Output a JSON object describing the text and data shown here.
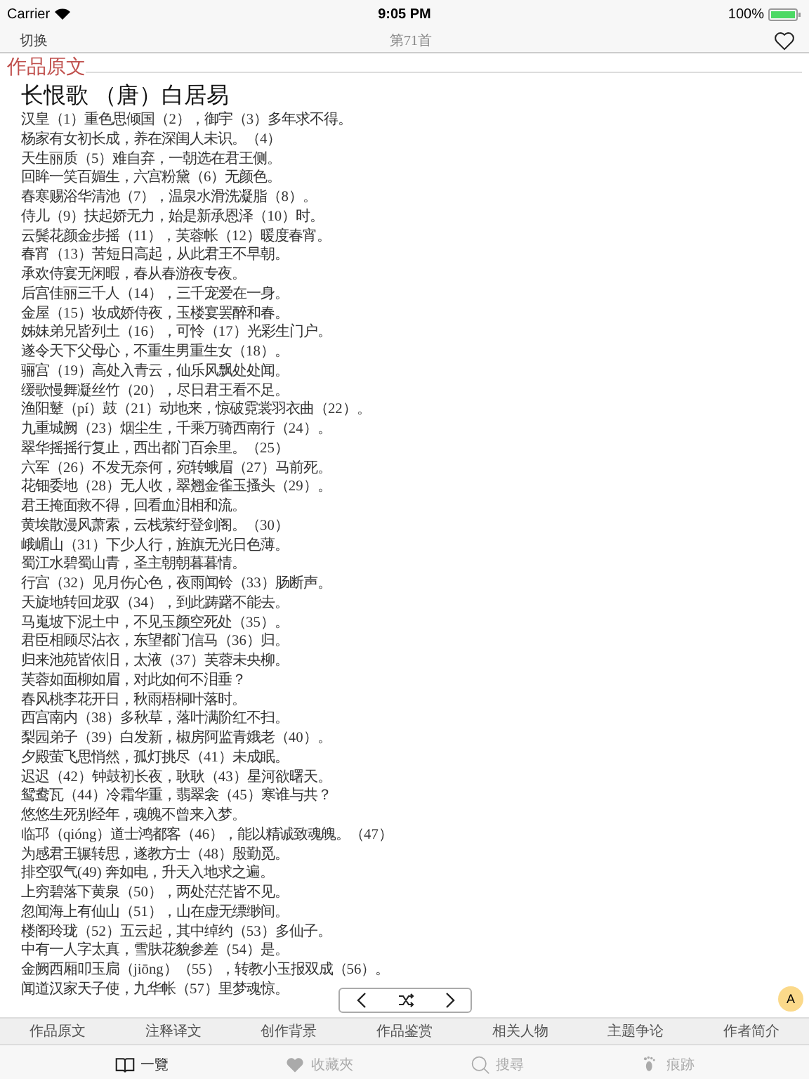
{
  "status_bar": {
    "carrier": "Carrier",
    "time": "9:05 PM",
    "battery": "100%"
  },
  "nav_bar": {
    "left_button": "切换",
    "title": "第71首",
    "favorited": false
  },
  "section_heading": "作品原文",
  "poem_title": "长恨歌 （唐）白居易",
  "lines": [
    "汉皇（1）重色思倾国（2），御宇（3）多年求不得。",
    "杨家有女初长成，养在深闺人未识。（4）",
    "天生丽质（5）难自弃，一朝选在君王侧。",
    "回眸一笑百媚生，六宫粉黛（6）无颜色。",
    "春寒赐浴华清池（7），温泉水滑洗凝脂（8）。",
    "侍儿（9）扶起娇无力，始是新承恩泽（10）时。",
    "云鬓花颜金步摇（11），芙蓉帐（12）暖度春宵。",
    "春宵（13）苦短日高起，从此君王不早朝。",
    "承欢侍宴无闲暇，春从春游夜专夜。",
    "后宫佳丽三千人（14），三千宠爱在一身。",
    "金屋（15）妆成娇侍夜，玉楼宴罢醉和春。",
    "姊妹弟兄皆列土（16），可怜（17）光彩生门户。",
    "遂令天下父母心，不重生男重生女（18）。",
    "骊宫（19）高处入青云，仙乐风飘处处闻。",
    "缓歌慢舞凝丝竹（20），尽日君王看不足。",
    "渔阳鼙（pí）鼓（21）动地来，惊破霓裳羽衣曲（22）。",
    "九重城阙（23）烟尘生，千乘万骑西南行（24）。",
    "翠华摇摇行复止，西出都门百余里。（25）",
    "六军（26）不发无奈何，宛转蛾眉（27）马前死。",
    "花钿委地（28）无人收，翠翘金雀玉搔头（29）。",
    "君王掩面救不得，回看血泪相和流。",
    "黄埃散漫风萧索，云栈萦纡登剑阁。（30）",
    "峨嵋山（31）下少人行，旌旗无光日色薄。",
    "蜀江水碧蜀山青，圣主朝朝暮暮情。",
    "行宫（32）见月伤心色，夜雨闻铃（33）肠断声。",
    "天旋地转回龙驭（34），到此踌躇不能去。",
    "马嵬坡下泥土中，不见玉颜空死处（35）。",
    "君臣相顾尽沾衣，东望都门信马（36）归。",
    "归来池苑皆依旧，太液（37）芙蓉未央柳。",
    "芙蓉如面柳如眉，对此如何不泪垂？",
    "春风桃李花开日，秋雨梧桐叶落时。",
    "西宫南内（38）多秋草，落叶满阶红不扫。",
    "梨园弟子（39）白发新，椒房阿监青娥老（40）。",
    "夕殿萤飞思悄然，孤灯挑尽（41）未成眠。",
    "迟迟（42）钟鼓初长夜，耿耿（43）星河欲曙天。",
    "鸳鸯瓦（44）冷霜华重，翡翠衾（45）寒谁与共？",
    "悠悠生死别经年，魂魄不曾来入梦。",
    "临邛（qióng）道士鸿都客（46），能以精诚致魂魄。（47）",
    "为感君王辗转思，遂教方士（48）殷勤觅。",
    "排空驭气(49) 奔如电，升天入地求之遍。",
    "上穷碧落下黄泉（50），两处茫茫皆不见。",
    "忽闻海上有仙山（51），山在虚无缥缈间。",
    "楼阁玲珑（52）五云起，其中绰约（53）多仙子。",
    "中有一人字太真，雪肤花貌参差（54）是。",
    "金阙西厢叩玉扃（jiōng）（55），转教小玉报双成（56）。",
    "闻道汉家天子使，九华帐（57）里梦魂惊。"
  ],
  "font_button": "A",
  "section_tabs": [
    "作品原文",
    "注释译文",
    "创作背景",
    "作品鉴赏",
    "相关人物",
    "主题争论",
    "作者简介"
  ],
  "bottom_tabs": [
    {
      "kind": "book",
      "label": "一覽",
      "selected": true
    },
    {
      "kind": "heart",
      "label": "收藏夾",
      "selected": false
    },
    {
      "kind": "search",
      "label": "搜尋",
      "selected": false
    },
    {
      "kind": "footprint",
      "label": "痕跡",
      "selected": false
    }
  ]
}
